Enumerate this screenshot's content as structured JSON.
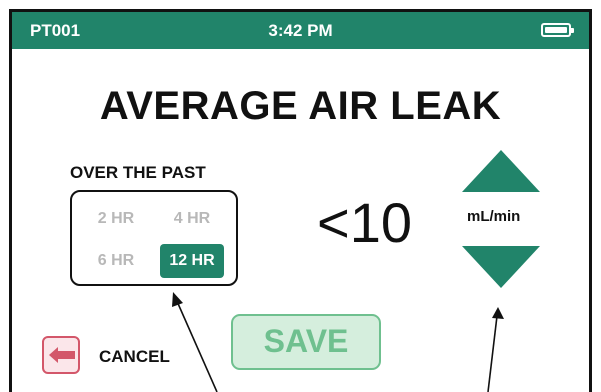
{
  "status_bar": {
    "patient_id": "PT001",
    "time": "3:42 PM",
    "battery_icon": "battery-full-icon"
  },
  "screen": {
    "title": "AVERAGE AIR LEAK",
    "period_label": "OVER THE PAST",
    "period_options": [
      "2 HR",
      "4 HR",
      "6 HR",
      "12 HR"
    ],
    "selected_period": "12 HR",
    "value": "<10",
    "unit": "mL/min",
    "increase_icon": "triangle-up-icon",
    "decrease_icon": "triangle-down-icon"
  },
  "actions": {
    "save_label": "SAVE",
    "cancel_label": "CANCEL",
    "cancel_icon": "arrow-left-icon"
  },
  "colors": {
    "accent_green": "#21846a",
    "save_fill": "#d5eedd",
    "save_text": "#6fc08f",
    "cancel_red": "#d3576a",
    "cancel_fill": "#fbe6ea",
    "inactive_option": "#b8b8b8"
  }
}
